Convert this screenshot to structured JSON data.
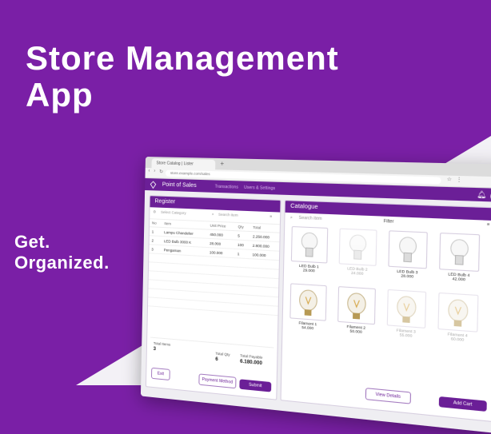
{
  "hero": {
    "headline_line1": "Store Management",
    "headline_line2": "App",
    "tagline_line1": "Get.",
    "tagline_line2": "Organized."
  },
  "colors": {
    "brand": "#7a1fa6",
    "appbar": "#6b1f97",
    "accent_light": "#f3f1f6"
  },
  "browser": {
    "tab_label": "Store Catalog | Lister",
    "url": "store.example.com/sales"
  },
  "app": {
    "title": "Point of Sales",
    "links": [
      "Transactions",
      "Users & Settings"
    ]
  },
  "register": {
    "title": "Register",
    "search_placeholder": "Select Category",
    "search2_placeholder": "Search item",
    "columns": [
      "No",
      "Item",
      "Unit Price",
      "Qty",
      "Total"
    ],
    "rows": [
      [
        "1",
        "Lampu Chandelier",
        "450.000",
        "5",
        "2.250.000"
      ],
      [
        "2",
        "LED Bulb 3000 K",
        "28.000",
        "100",
        "2.800.000"
      ],
      [
        "3",
        "Pengaman",
        "100.000",
        "1",
        "100.000"
      ]
    ],
    "total_items_label": "Total Items",
    "total_items": "3",
    "total_qty_label": "Total Qty",
    "total_qty": "6",
    "total_payable_label": "Total Payable",
    "total_payable": "6.180.000",
    "exit_label": "Exit",
    "payment_label": "Payment Method",
    "submit_label": "Submit"
  },
  "catalogue": {
    "title": "Catalogue",
    "search_placeholder": "Search item",
    "filter_label": "Filter",
    "items": [
      {
        "name": "LED Bulb 1",
        "price": "29.000",
        "dim": false
      },
      {
        "name": "LED Bulb 2",
        "price": "24.000",
        "dim": true
      },
      {
        "name": "LED Bulb 3",
        "price": "28.000",
        "dim": false
      },
      {
        "name": "LED Bulb 4",
        "price": "42.000",
        "dim": false
      },
      {
        "name": "Filament 1",
        "price": "54.000",
        "dim": false
      },
      {
        "name": "Filament 2",
        "price": "50.000",
        "dim": false
      },
      {
        "name": "Filament 3",
        "price": "55.000",
        "dim": true
      },
      {
        "name": "Filament 4",
        "price": "60.000",
        "dim": true
      }
    ],
    "view_details_label": "View Details",
    "add_cart_label": "Add Cart"
  }
}
